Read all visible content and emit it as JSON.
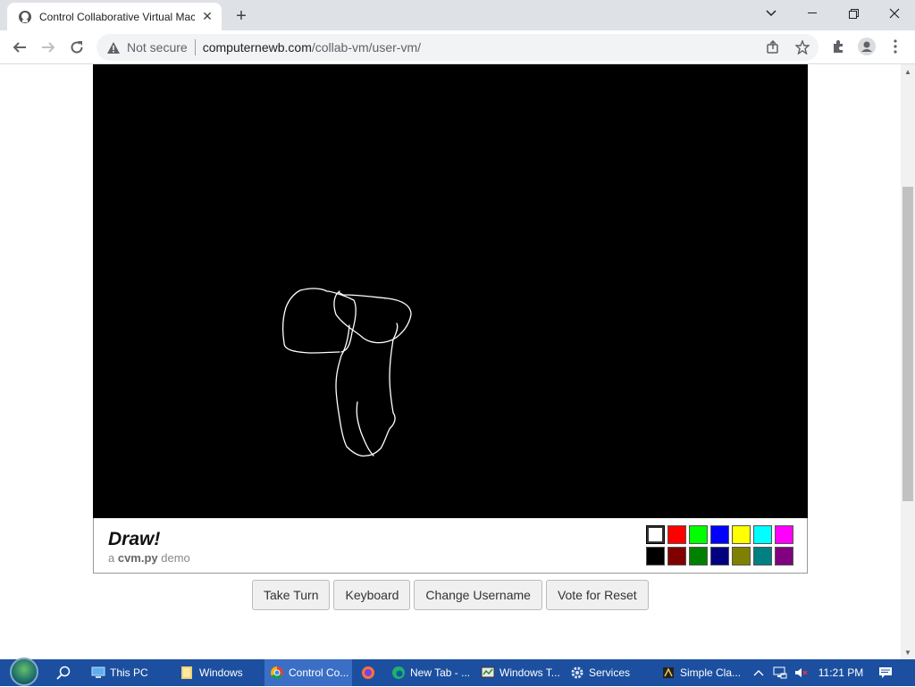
{
  "browser": {
    "tab_title": "Control Collaborative Virtual Machine",
    "address": {
      "security_label": "Not secure",
      "host": "computernewb.com",
      "path": "/collab-vm/user-vm/"
    }
  },
  "vm": {
    "app_title": "Draw!",
    "subtitle_prefix": "a ",
    "subtitle_bold": "cvm.py",
    "subtitle_suffix": " demo",
    "palette": [
      {
        "color": "#ffffff",
        "selected": true
      },
      {
        "color": "#ff0000"
      },
      {
        "color": "#00ff00"
      },
      {
        "color": "#0000ff"
      },
      {
        "color": "#ffff00"
      },
      {
        "color": "#00ffff"
      },
      {
        "color": "#ff00ff"
      },
      {
        "color": "#000000"
      },
      {
        "color": "#800000"
      },
      {
        "color": "#008000"
      },
      {
        "color": "#000080"
      },
      {
        "color": "#808000"
      },
      {
        "color": "#008080"
      },
      {
        "color": "#800080"
      }
    ],
    "buttons": {
      "take_turn": "Take Turn",
      "keyboard": "Keyboard",
      "change_username": "Change Username",
      "vote_reset": "Vote for Reset"
    }
  },
  "taskbar": {
    "items": [
      {
        "label": "This PC",
        "icon": "monitor-icon"
      },
      {
        "label": "Windows",
        "icon": "folder-icon"
      },
      {
        "label": "Control Co...",
        "icon": "chrome-icon",
        "active": true
      },
      {
        "label": "",
        "icon": "firefox-icon"
      },
      {
        "label": "New Tab - ...",
        "icon": "edge-icon"
      },
      {
        "label": "Windows T...",
        "icon": "task-manager-icon"
      },
      {
        "label": "Services",
        "icon": "gear-icon"
      },
      {
        "label": "Simple Cla...",
        "icon": "app-icon"
      }
    ],
    "clock": "11:21 PM"
  }
}
